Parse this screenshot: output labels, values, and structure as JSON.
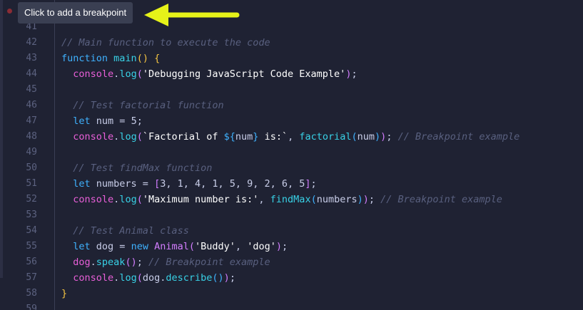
{
  "tooltip": {
    "text": "Click to add a breakpoint"
  },
  "annotation": {
    "icon": "arrow-left-icon",
    "color": "#e6f219"
  },
  "lines": [
    {
      "number": "41",
      "tokens": []
    },
    {
      "number": "42",
      "tokens": [
        {
          "t": "// Main function to execute the code",
          "c": "cm"
        }
      ]
    },
    {
      "number": "43",
      "tokens": [
        {
          "t": "function",
          "c": "kw"
        },
        {
          "t": " ",
          "c": "pl"
        },
        {
          "t": "main",
          "c": "fn"
        },
        {
          "t": "()",
          "c": "br"
        },
        {
          "t": " ",
          "c": "pl"
        },
        {
          "t": "{",
          "c": "br"
        }
      ]
    },
    {
      "number": "44",
      "tokens": [
        {
          "t": "  ",
          "c": "pl"
        },
        {
          "t": "console",
          "c": "obj"
        },
        {
          "t": ".",
          "c": "pl"
        },
        {
          "t": "log",
          "c": "fn"
        },
        {
          "t": "(",
          "c": "br2"
        },
        {
          "t": "'Debugging JavaScript Code Example'",
          "c": "str"
        },
        {
          "t": ")",
          "c": "br2"
        },
        {
          "t": ";",
          "c": "pl"
        }
      ]
    },
    {
      "number": "45",
      "tokens": []
    },
    {
      "number": "46",
      "tokens": [
        {
          "t": "  ",
          "c": "pl"
        },
        {
          "t": "// Test factorial function",
          "c": "cm"
        }
      ]
    },
    {
      "number": "47",
      "tokens": [
        {
          "t": "  ",
          "c": "pl"
        },
        {
          "t": "let",
          "c": "kw"
        },
        {
          "t": " num = ",
          "c": "pl"
        },
        {
          "t": "5",
          "c": "num"
        },
        {
          "t": ";",
          "c": "pl"
        }
      ]
    },
    {
      "number": "48",
      "tokens": [
        {
          "t": "  ",
          "c": "pl"
        },
        {
          "t": "console",
          "c": "obj"
        },
        {
          "t": ".",
          "c": "pl"
        },
        {
          "t": "log",
          "c": "fn"
        },
        {
          "t": "(",
          "c": "br2"
        },
        {
          "t": "`Factorial of ",
          "c": "str"
        },
        {
          "t": "${",
          "c": "kw"
        },
        {
          "t": "num",
          "c": "pl"
        },
        {
          "t": "}",
          "c": "kw"
        },
        {
          "t": " is:`",
          "c": "str"
        },
        {
          "t": ", ",
          "c": "pl"
        },
        {
          "t": "factorial",
          "c": "fn"
        },
        {
          "t": "(",
          "c": "kw"
        },
        {
          "t": "num",
          "c": "pl"
        },
        {
          "t": ")",
          "c": "kw"
        },
        {
          "t": ")",
          "c": "br2"
        },
        {
          "t": "; ",
          "c": "pl"
        },
        {
          "t": "// Breakpoint example",
          "c": "cm"
        }
      ]
    },
    {
      "number": "49",
      "tokens": []
    },
    {
      "number": "50",
      "tokens": [
        {
          "t": "  ",
          "c": "pl"
        },
        {
          "t": "// Test findMax function",
          "c": "cm"
        }
      ]
    },
    {
      "number": "51",
      "tokens": [
        {
          "t": "  ",
          "c": "pl"
        },
        {
          "t": "let",
          "c": "kw"
        },
        {
          "t": " numbers = ",
          "c": "pl"
        },
        {
          "t": "[",
          "c": "br2"
        },
        {
          "t": "3, 1, 4, 1, 5, 9, 2, 6, 5",
          "c": "num"
        },
        {
          "t": "]",
          "c": "br2"
        },
        {
          "t": ";",
          "c": "pl"
        }
      ]
    },
    {
      "number": "52",
      "tokens": [
        {
          "t": "  ",
          "c": "pl"
        },
        {
          "t": "console",
          "c": "obj"
        },
        {
          "t": ".",
          "c": "pl"
        },
        {
          "t": "log",
          "c": "fn"
        },
        {
          "t": "(",
          "c": "br2"
        },
        {
          "t": "'Maximum number is:'",
          "c": "str"
        },
        {
          "t": ", ",
          "c": "pl"
        },
        {
          "t": "findMax",
          "c": "fn"
        },
        {
          "t": "(",
          "c": "kw"
        },
        {
          "t": "numbers",
          "c": "pl"
        },
        {
          "t": ")",
          "c": "kw"
        },
        {
          "t": ")",
          "c": "br2"
        },
        {
          "t": "; ",
          "c": "pl"
        },
        {
          "t": "// Breakpoint example",
          "c": "cm"
        }
      ]
    },
    {
      "number": "53",
      "tokens": []
    },
    {
      "number": "54",
      "tokens": [
        {
          "t": "  ",
          "c": "pl"
        },
        {
          "t": "// Test Animal class",
          "c": "cm"
        }
      ]
    },
    {
      "number": "55",
      "tokens": [
        {
          "t": "  ",
          "c": "pl"
        },
        {
          "t": "let",
          "c": "kw"
        },
        {
          "t": " dog = ",
          "c": "pl"
        },
        {
          "t": "new",
          "c": "kw"
        },
        {
          "t": " ",
          "c": "pl"
        },
        {
          "t": "Animal",
          "c": "br2"
        },
        {
          "t": "(",
          "c": "br2"
        },
        {
          "t": "'Buddy'",
          "c": "str"
        },
        {
          "t": ", ",
          "c": "pl"
        },
        {
          "t": "'dog'",
          "c": "str"
        },
        {
          "t": ")",
          "c": "br2"
        },
        {
          "t": ";",
          "c": "pl"
        }
      ]
    },
    {
      "number": "56",
      "tokens": [
        {
          "t": "  ",
          "c": "pl"
        },
        {
          "t": "dog",
          "c": "obj"
        },
        {
          "t": ".",
          "c": "pl"
        },
        {
          "t": "speak",
          "c": "fn"
        },
        {
          "t": "()",
          "c": "br2"
        },
        {
          "t": "; ",
          "c": "pl"
        },
        {
          "t": "// Breakpoint example",
          "c": "cm"
        }
      ]
    },
    {
      "number": "57",
      "tokens": [
        {
          "t": "  ",
          "c": "pl"
        },
        {
          "t": "console",
          "c": "obj"
        },
        {
          "t": ".",
          "c": "pl"
        },
        {
          "t": "log",
          "c": "fn"
        },
        {
          "t": "(",
          "c": "br2"
        },
        {
          "t": "dog",
          "c": "pl"
        },
        {
          "t": ".",
          "c": "pl"
        },
        {
          "t": "describe",
          "c": "fn"
        },
        {
          "t": "()",
          "c": "kw"
        },
        {
          "t": ")",
          "c": "br2"
        },
        {
          "t": ";",
          "c": "pl"
        }
      ]
    },
    {
      "number": "58",
      "tokens": [
        {
          "t": "}",
          "c": "br"
        }
      ]
    },
    {
      "number": "59",
      "tokens": []
    }
  ]
}
